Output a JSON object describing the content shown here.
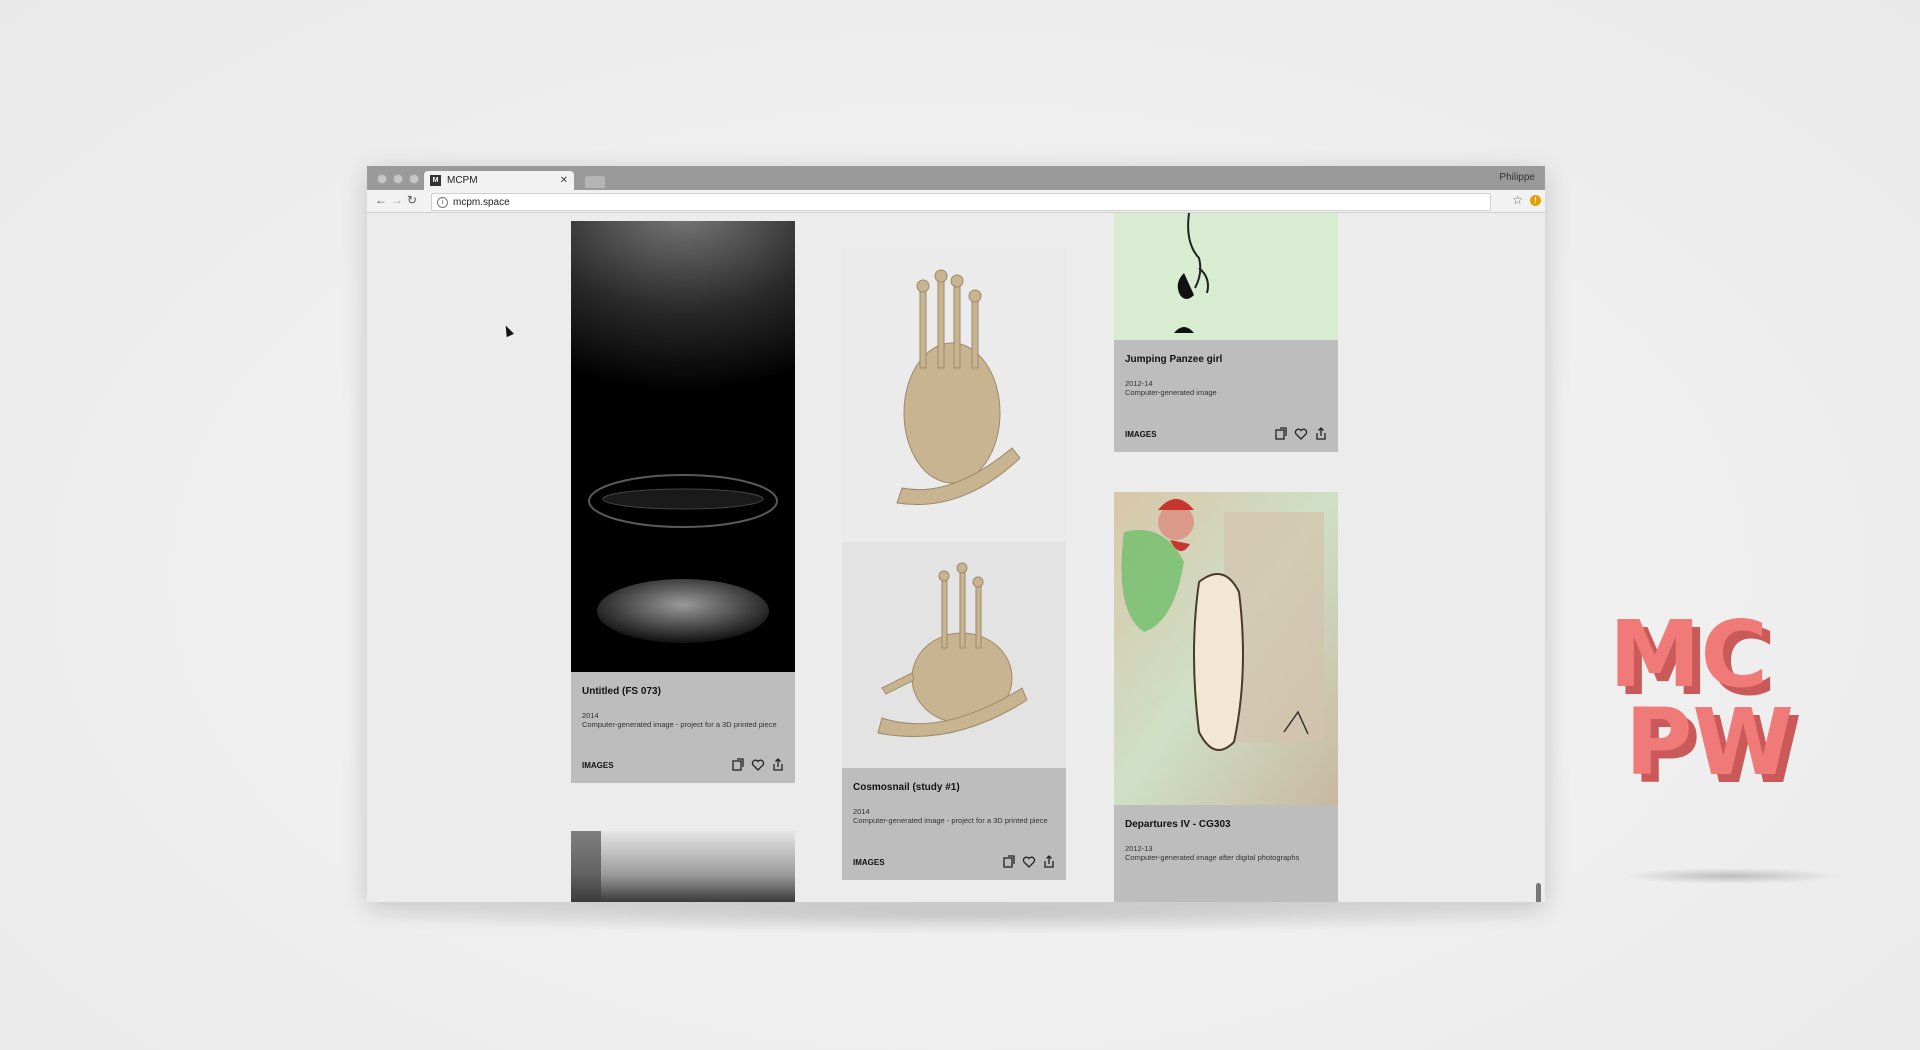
{
  "window": {
    "tab_title": "MCPM",
    "favicon_text": "M",
    "profile_name": "Philippe",
    "url": "mcpm.space"
  },
  "cards": [
    {
      "title": "Untitled (FS 073)",
      "year": "2014",
      "description": "Computer-generated image - project for a 3D printed piece",
      "category": "IMAGES"
    },
    {
      "title": "Cosmosnail (study #1)",
      "year": "2014",
      "description": "Computer-generated image - project for a 3D printed piece",
      "category": "IMAGES"
    },
    {
      "title": "Jumping Panzee girl",
      "year": "2012-14",
      "description": "Computer-generated image",
      "category": "IMAGES"
    },
    {
      "title": "Departures IV - CG303",
      "year": "2012-13",
      "description": "Computer-generated image after digital photographs",
      "category": "IMAGES"
    }
  ],
  "logo": {
    "line1": "MC",
    "line2": "PW",
    "color": "#f07a78"
  },
  "icons": [
    "repost-icon",
    "heart-icon",
    "share-icon"
  ]
}
